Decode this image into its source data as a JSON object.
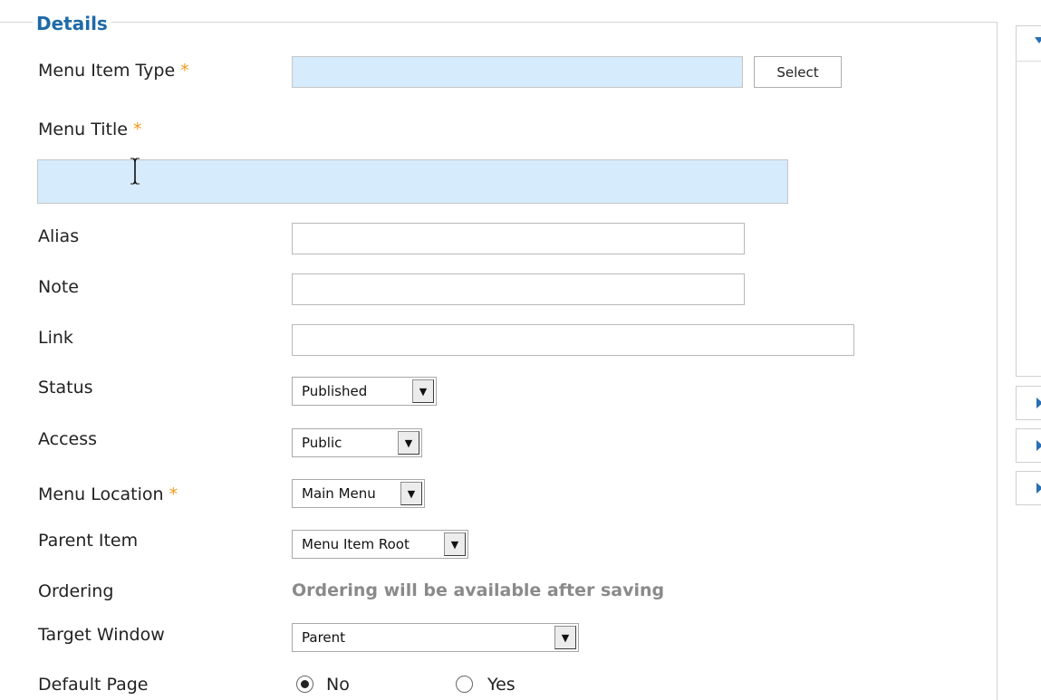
{
  "section": {
    "legend": "Details"
  },
  "fields": {
    "menu_item_type": {
      "label": "Menu Item Type",
      "required_mark": "*",
      "value": "",
      "button": "Select"
    },
    "menu_title": {
      "label": "Menu Title",
      "required_mark": "*",
      "value": ""
    },
    "alias": {
      "label": "Alias",
      "value": ""
    },
    "note": {
      "label": "Note",
      "value": ""
    },
    "link": {
      "label": "Link",
      "value": ""
    },
    "status": {
      "label": "Status",
      "selected": "Published"
    },
    "access": {
      "label": "Access",
      "selected": "Public"
    },
    "menu_location": {
      "label": "Menu Location",
      "required_mark": "*",
      "selected": "Main Menu"
    },
    "parent_item": {
      "label": "Parent Item",
      "selected": "Menu Item Root"
    },
    "ordering": {
      "label": "Ordering",
      "text": "Ordering will be available after saving"
    },
    "target_window": {
      "label": "Target Window",
      "selected": "Parent"
    },
    "default_page": {
      "label": "Default Page",
      "options": [
        "No",
        "Yes"
      ],
      "selected": "No"
    }
  },
  "icons": {
    "dropdown_arrow": "▼",
    "side_panel_collapse": "triangle-down-icon",
    "side_panel_expand": "triangle-right-icon",
    "text_cursor": "i-beam-cursor-icon"
  },
  "colors": {
    "legend": "#1e6aa8",
    "required_star": "#f39a1e",
    "required_input_bg": "#d6ebfb",
    "info_text": "#8a8a8a"
  }
}
